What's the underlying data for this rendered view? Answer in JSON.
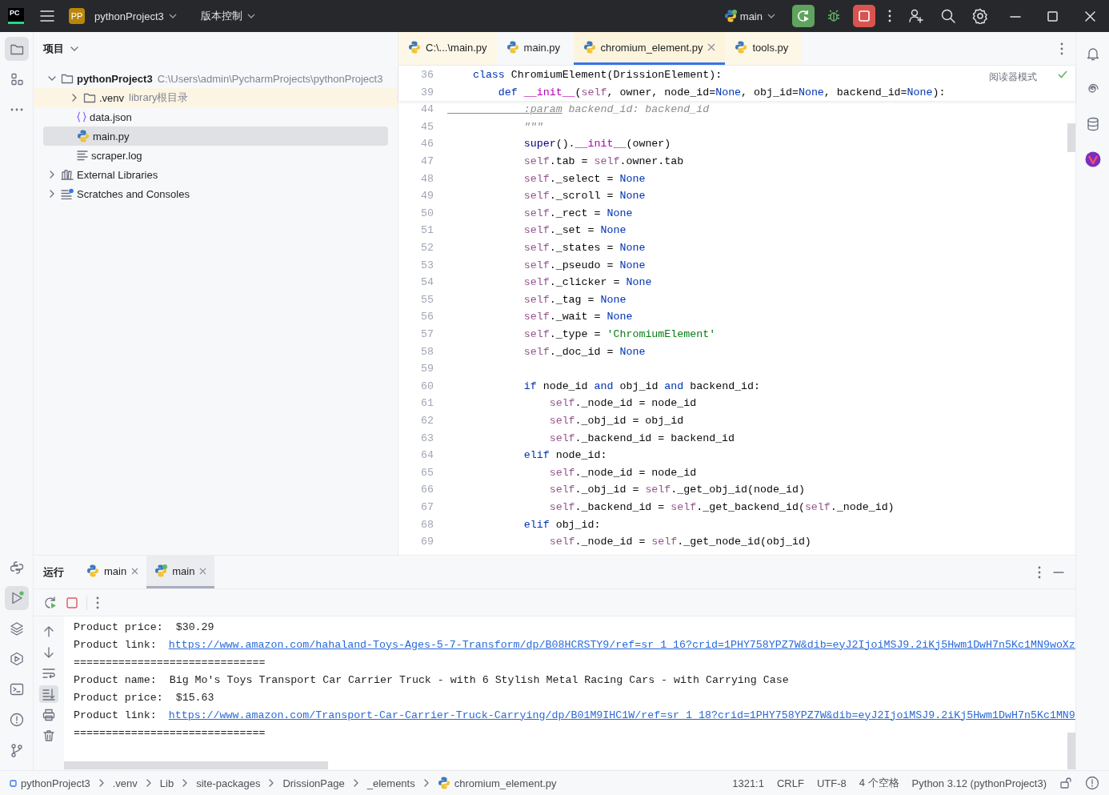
{
  "title_bar": {
    "logo": "PC",
    "project_badge": "PP",
    "project": "pythonProject3",
    "vcs": "版本控制",
    "run_config": "main"
  },
  "left_stripe": {
    "top": [
      {
        "kind": "project",
        "selected": true
      },
      {
        "kind": "structure",
        "selected": false
      },
      {
        "kind": "more",
        "selected": false
      }
    ],
    "bottom": [
      {
        "kind": "python_console",
        "selected": false
      },
      {
        "kind": "run",
        "selected": true
      },
      {
        "kind": "packages",
        "selected": false
      },
      {
        "kind": "services",
        "selected": false
      },
      {
        "kind": "terminal",
        "selected": false
      },
      {
        "kind": "problems",
        "selected": false
      },
      {
        "kind": "git",
        "selected": false
      }
    ]
  },
  "project_panel": {
    "title": "项目",
    "tree": [
      {
        "kind": "folder",
        "name": "pythonProject3",
        "hint": "C:\\Users\\admin\\PycharmProjects\\pythonProject3",
        "bold": true,
        "expanded": true,
        "selected": false,
        "children": [
          {
            "kind": "library_folder",
            "name": ".venv",
            "hint": "library根目录",
            "expanded": false,
            "selected": false
          },
          {
            "kind": "json",
            "name": "data.json",
            "selected": false
          },
          {
            "kind": "python",
            "name": "main.py",
            "selected": true
          },
          {
            "kind": "log",
            "name": "scraper.log",
            "selected": false
          }
        ]
      },
      {
        "kind": "libraries",
        "name": "External Libraries",
        "expanded": false,
        "selected": false
      },
      {
        "kind": "scratches",
        "name": "Scratches and Consoles",
        "expanded": false,
        "selected": false
      }
    ]
  },
  "editor": {
    "tabs": [
      {
        "label": "C:\\...\\main.py",
        "selected": false,
        "external": true
      },
      {
        "label": "main.py",
        "selected": false,
        "external": false
      },
      {
        "label": "chromium_element.py",
        "selected": true,
        "external": true
      },
      {
        "label": "tools.py",
        "selected": false,
        "external": true
      }
    ],
    "reader_mode": "阅读器模式",
    "sticky_lines": [
      {
        "number": "36",
        "tokens": [
          {
            "kind": "keyword",
            "text": "    class"
          },
          {
            "kind": "plain",
            "text": " ChromiumElement(DrissionElement):"
          }
        ]
      },
      {
        "number": "39",
        "tokens": [
          {
            "kind": "keyword",
            "text": "        def "
          },
          {
            "kind": "magic",
            "text": "__init__"
          },
          {
            "kind": "plain",
            "text": "("
          },
          {
            "kind": "self",
            "text": "self"
          },
          {
            "kind": "plain",
            "text": ", owner, node_id="
          },
          {
            "kind": "keyword",
            "text": "None"
          },
          {
            "kind": "plain",
            "text": ", obj_id="
          },
          {
            "kind": "keyword",
            "text": "None"
          },
          {
            "kind": "plain",
            "text": ", backend_id="
          },
          {
            "kind": "keyword",
            "text": "None"
          },
          {
            "kind": "plain",
            "text": "):"
          }
        ]
      }
    ],
    "lines": [
      {
        "number": "44",
        "tokens": [
          {
            "kind": "doc_tag",
            "text": "            :param"
          },
          {
            "kind": "comment",
            "text": " backend_id: backend_id"
          }
        ]
      },
      {
        "number": "45",
        "tokens": [
          {
            "kind": "comment",
            "text": "            \"\"\""
          }
        ]
      },
      {
        "number": "46",
        "tokens": [
          {
            "kind": "builtin",
            "text": "            super"
          },
          {
            "kind": "plain",
            "text": "()."
          },
          {
            "kind": "magic",
            "text": "__init__"
          },
          {
            "kind": "plain",
            "text": "(owner)"
          }
        ]
      },
      {
        "number": "47",
        "tokens": [
          {
            "kind": "self",
            "text": "            self"
          },
          {
            "kind": "plain",
            "text": ".tab = "
          },
          {
            "kind": "self",
            "text": "self"
          },
          {
            "kind": "plain",
            "text": ".owner.tab"
          }
        ]
      },
      {
        "number": "48",
        "tokens": [
          {
            "kind": "self",
            "text": "            self"
          },
          {
            "kind": "plain",
            "text": "._select = "
          },
          {
            "kind": "keyword",
            "text": "None"
          }
        ]
      },
      {
        "number": "49",
        "tokens": [
          {
            "kind": "self",
            "text": "            self"
          },
          {
            "kind": "plain",
            "text": "._scroll = "
          },
          {
            "kind": "keyword",
            "text": "None"
          }
        ]
      },
      {
        "number": "50",
        "tokens": [
          {
            "kind": "self",
            "text": "            self"
          },
          {
            "kind": "plain",
            "text": "._rect = "
          },
          {
            "kind": "keyword",
            "text": "None"
          }
        ]
      },
      {
        "number": "51",
        "tokens": [
          {
            "kind": "self",
            "text": "            self"
          },
          {
            "kind": "plain",
            "text": "._set = "
          },
          {
            "kind": "keyword",
            "text": "None"
          }
        ]
      },
      {
        "number": "52",
        "tokens": [
          {
            "kind": "self",
            "text": "            self"
          },
          {
            "kind": "plain",
            "text": "._states = "
          },
          {
            "kind": "keyword",
            "text": "None"
          }
        ]
      },
      {
        "number": "53",
        "tokens": [
          {
            "kind": "self",
            "text": "            self"
          },
          {
            "kind": "plain",
            "text": "._pseudo = "
          },
          {
            "kind": "keyword",
            "text": "None"
          }
        ]
      },
      {
        "number": "54",
        "tokens": [
          {
            "kind": "self",
            "text": "            self"
          },
          {
            "kind": "plain",
            "text": "._clicker = "
          },
          {
            "kind": "keyword",
            "text": "None"
          }
        ]
      },
      {
        "number": "55",
        "tokens": [
          {
            "kind": "self",
            "text": "            self"
          },
          {
            "kind": "plain",
            "text": "._tag = "
          },
          {
            "kind": "keyword",
            "text": "None"
          }
        ]
      },
      {
        "number": "56",
        "tokens": [
          {
            "kind": "self",
            "text": "            self"
          },
          {
            "kind": "plain",
            "text": "._wait = "
          },
          {
            "kind": "keyword",
            "text": "None"
          }
        ]
      },
      {
        "number": "57",
        "tokens": [
          {
            "kind": "self",
            "text": "            self"
          },
          {
            "kind": "plain",
            "text": "._type = "
          },
          {
            "kind": "string",
            "text": "'ChromiumElement'"
          }
        ]
      },
      {
        "number": "58",
        "tokens": [
          {
            "kind": "self",
            "text": "            self"
          },
          {
            "kind": "plain",
            "text": "._doc_id = "
          },
          {
            "kind": "keyword",
            "text": "None"
          }
        ]
      },
      {
        "number": "59"
      },
      {
        "number": "60",
        "tokens": [
          {
            "kind": "keyword",
            "text": "            if"
          },
          {
            "kind": "plain",
            "text": " node_id "
          },
          {
            "kind": "keyword",
            "text": "and"
          },
          {
            "kind": "plain",
            "text": " obj_id "
          },
          {
            "kind": "keyword",
            "text": "and"
          },
          {
            "kind": "plain",
            "text": " backend_id:"
          }
        ]
      },
      {
        "number": "61",
        "tokens": [
          {
            "kind": "self",
            "text": "                self"
          },
          {
            "kind": "plain",
            "text": "._node_id = node_id"
          }
        ]
      },
      {
        "number": "62",
        "tokens": [
          {
            "kind": "self",
            "text": "                self"
          },
          {
            "kind": "plain",
            "text": "._obj_id = obj_id"
          }
        ]
      },
      {
        "number": "63",
        "tokens": [
          {
            "kind": "self",
            "text": "                self"
          },
          {
            "kind": "plain",
            "text": "._backend_id = backend_id"
          }
        ]
      },
      {
        "number": "64",
        "tokens": [
          {
            "kind": "keyword",
            "text": "            elif"
          },
          {
            "kind": "plain",
            "text": " node_id:"
          }
        ]
      },
      {
        "number": "65",
        "tokens": [
          {
            "kind": "self",
            "text": "                self"
          },
          {
            "kind": "plain",
            "text": "._node_id = node_id"
          }
        ]
      },
      {
        "number": "66",
        "tokens": [
          {
            "kind": "self",
            "text": "                self"
          },
          {
            "kind": "plain",
            "text": "._obj_id = "
          },
          {
            "kind": "self",
            "text": "self"
          },
          {
            "kind": "plain",
            "text": "._get_obj_id(node_id)"
          }
        ]
      },
      {
        "number": "67",
        "tokens": [
          {
            "kind": "self",
            "text": "                self"
          },
          {
            "kind": "plain",
            "text": "._backend_id = "
          },
          {
            "kind": "self",
            "text": "self"
          },
          {
            "kind": "plain",
            "text": "._get_backend_id("
          },
          {
            "kind": "self",
            "text": "self"
          },
          {
            "kind": "plain",
            "text": "._node_id)"
          }
        ]
      },
      {
        "number": "68",
        "tokens": [
          {
            "kind": "keyword",
            "text": "            elif"
          },
          {
            "kind": "plain",
            "text": " obj_id:"
          }
        ]
      },
      {
        "number": "69",
        "tokens": [
          {
            "kind": "self",
            "text": "                self"
          },
          {
            "kind": "plain",
            "text": "._node_id = "
          },
          {
            "kind": "self",
            "text": "self"
          },
          {
            "kind": "plain",
            "text": "._get_node_id(obj_id)"
          }
        ]
      }
    ]
  },
  "run_panel": {
    "title": "运行",
    "tabs": [
      {
        "label": "main",
        "selected": false,
        "running": false
      },
      {
        "label": "main",
        "selected": true,
        "running": true
      }
    ],
    "console": [
      {
        "kind": "text",
        "text": "Product price:  $30.29"
      },
      {
        "kind": "link",
        "label": "Product link:",
        "url": "https://www.amazon.com/hahaland-Toys-Ages-5-7-Transform/dp/B08HCRSTY9/ref=sr_1_16?crid=1PHY758YPZ7W&dib=eyJ2IjoiMSJ9.2iKj5Hwm1DwH7n5Kc1MN9woXz"
      },
      {
        "kind": "text",
        "text": "=============================="
      },
      {
        "kind": "text",
        "text": "Product name:  Big Mo's Toys Transport Car Carrier Truck - with 6 Stylish Metal Racing Cars - with Carrying Case"
      },
      {
        "kind": "text",
        "text": "Product price:  $15.63"
      },
      {
        "kind": "link",
        "label": "Product link:",
        "url": "https://www.amazon.com/Transport-Car-Carrier-Truck-Carrying/dp/B01M9IHC1W/ref=sr_1_18?crid=1PHY758YPZ7W&dib=eyJ2IjoiMSJ9.2iKj5Hwm1DwH7n5Kc1MN9"
      },
      {
        "kind": "text",
        "text": "=============================="
      }
    ]
  },
  "status_bar": {
    "breadcrumbs": [
      "pythonProject3",
      ".venv",
      "Lib",
      "site-packages",
      "DrissionPage",
      "_elements",
      "chromium_element.py"
    ],
    "items": [
      "1321:1",
      "CRLF",
      "UTF-8",
      "4 个空格",
      "Python 3.12 (pythonProject3)"
    ]
  }
}
